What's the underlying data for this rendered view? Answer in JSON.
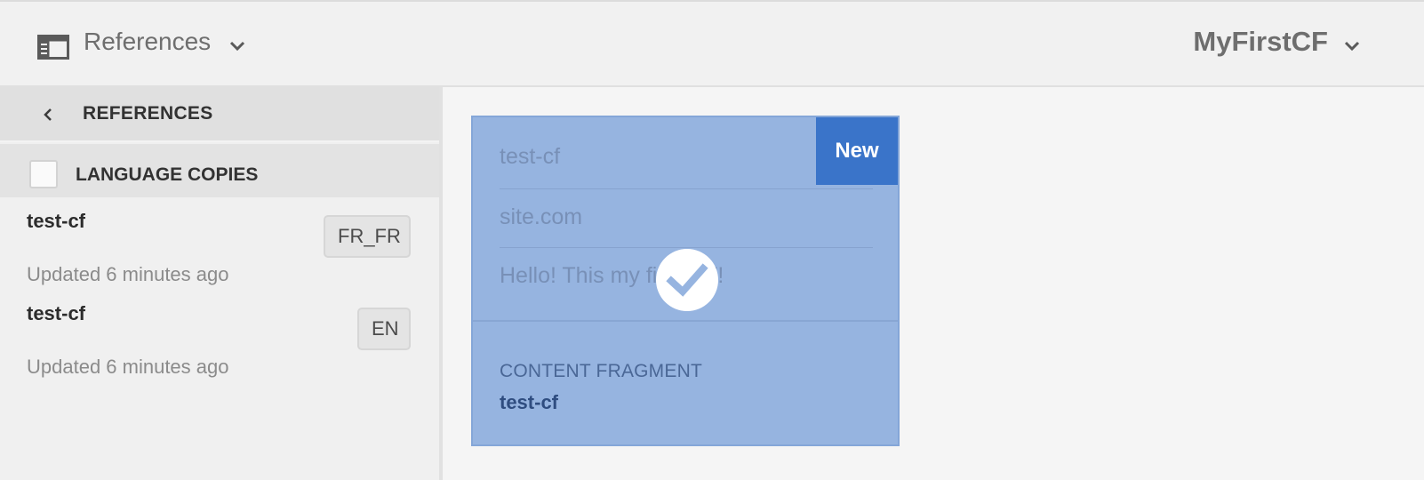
{
  "header": {
    "rail_title": "References",
    "document_title": "MyFirstCF"
  },
  "rail": {
    "header_label": "REFERENCES",
    "section_label": "LANGUAGE COPIES",
    "items": [
      {
        "name": "test-cf",
        "updated": "Updated 6 minutes ago",
        "badge": "FR_FR"
      },
      {
        "name": "test-cf",
        "updated": "Updated 6 minutes ago",
        "badge": "EN"
      }
    ]
  },
  "card": {
    "badge": "New",
    "lines": [
      "test-cf",
      "site.com",
      "Hello! This my first CF!"
    ],
    "type_label": "CONTENT FRAGMENT",
    "title": "test-cf"
  },
  "colors": {
    "card_selected": "#96b4e0",
    "new_badge": "#3a74c9",
    "card_title": "#2f4d80"
  },
  "icons": {
    "rail_toggle": "rail-toggle-icon",
    "dropdown": "chevron-down-icon",
    "back": "chevron-left-icon",
    "selected": "checkmark-icon"
  }
}
